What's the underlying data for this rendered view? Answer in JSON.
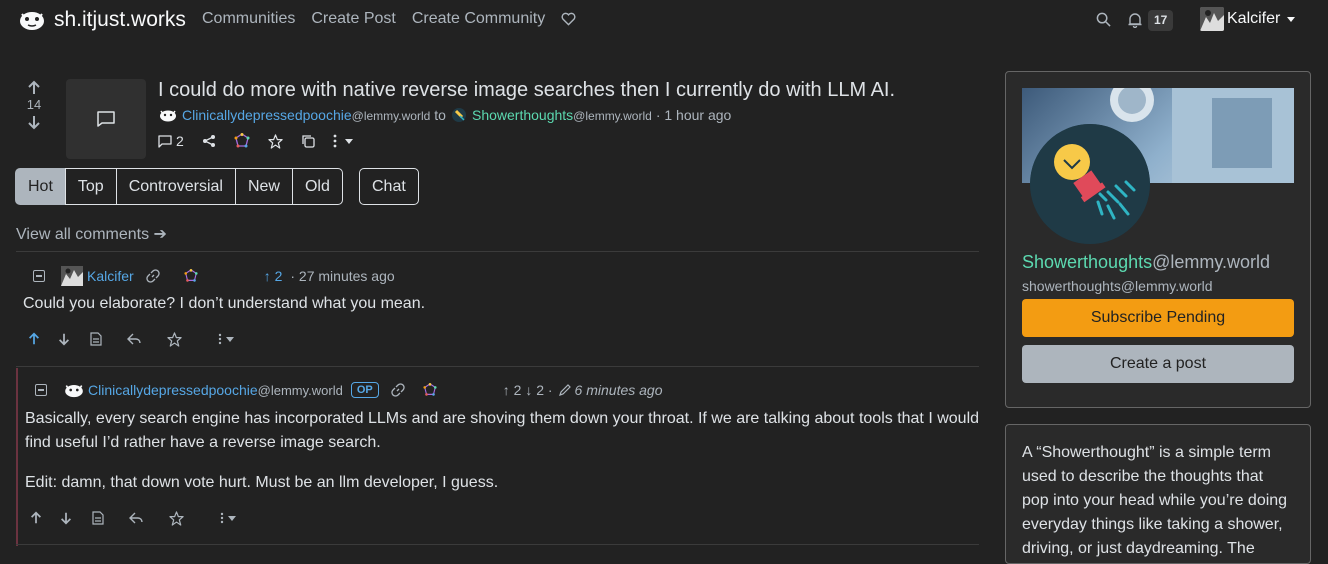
{
  "site": {
    "name": "sh.itjust.works"
  },
  "nav": {
    "links": [
      "Communities",
      "Create Post",
      "Create Community"
    ],
    "notification_count": "17",
    "username": "Kalcifer"
  },
  "post": {
    "score": "14",
    "title": "I could do more with native reverse image searches then I currently do with LLM AI.",
    "author": "Clinicallydepressedpoochie",
    "author_host": "@lemmy.world",
    "to": "to",
    "community": "Showerthoughts",
    "community_host": "@lemmy.world",
    "time": "· 1 hour ago",
    "comment_count": "2"
  },
  "sort": {
    "options": [
      "Hot",
      "Top",
      "Controversial",
      "New",
      "Old"
    ],
    "active": "Hot",
    "chat_label": "Chat"
  },
  "view_all": "View all comments ➔",
  "comments": [
    {
      "author": "Kalcifer",
      "upvotes": "↑ 2",
      "time": "· 27 minutes ago",
      "body": "Could you elaborate? I don’t understand what you mean."
    },
    {
      "author": "Clinicallydepressedpoochie",
      "author_host": "@lemmy.world",
      "badge": "OP",
      "votes": "↑ 2 ↓ 2 ·",
      "time": "6 minutes ago",
      "body_1": "Basically, every search engine has incorporated LLMs and are shoving them down your throat. If we are talking about tools that I would find useful I’d rather have a reverse image search.",
      "body_2": "Edit: damn, that down vote hurt. Must be an llm developer, I guess."
    }
  ],
  "sidebar": {
    "community_name": "Showerthoughts",
    "community_host": "@lemmy.world",
    "community_handle": "showerthoughts@lemmy.world",
    "subscribe_label": "Subscribe Pending",
    "create_post_label": "Create a post",
    "about": "A “Showerthought” is a simple term used to describe the thoughts that pop into your head while you’re doing everyday things like taking a shower, driving, or just daydreaming. The"
  },
  "colors": {
    "accent": "#56a7e5",
    "community": "#5cd9b0",
    "subscribe": "#f39c12",
    "background": "#222222"
  }
}
